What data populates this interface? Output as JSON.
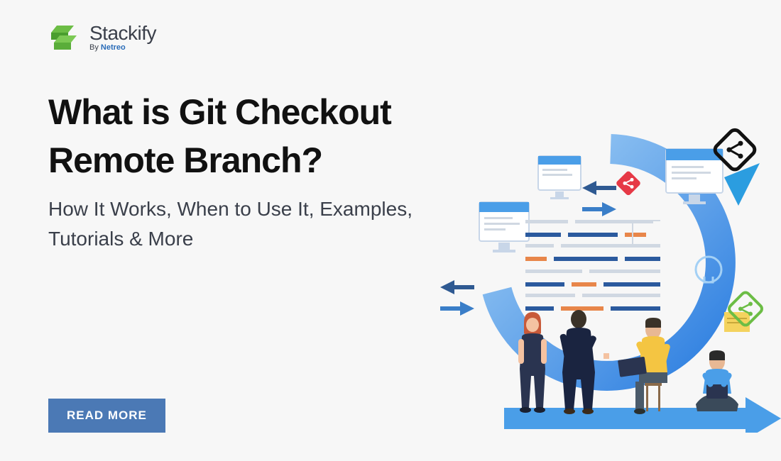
{
  "logo": {
    "name": "Stackify",
    "byline_prefix": "By ",
    "byline_brand": "Netreo"
  },
  "content": {
    "title": "What is Git Checkout Remote Branch?",
    "subtitle": "How It Works, When to Use It, Examples, Tutorials & More"
  },
  "cta": {
    "label": "READ MORE"
  },
  "colors": {
    "primary_green": "#6cbd45",
    "btn_blue": "#4b79b5",
    "text_dark": "#111",
    "text_mid": "#3a3f4a"
  }
}
